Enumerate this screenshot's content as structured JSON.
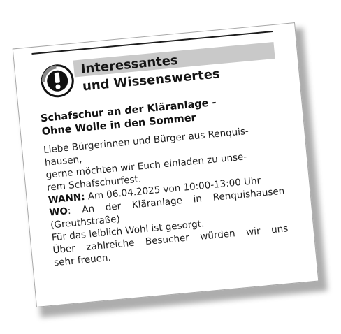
{
  "notice": {
    "header_title_line1": "Interessantes",
    "header_title_line2": "und Wissenswertes",
    "headline_line1": "Schafschur an der Kläranlage -",
    "headline_line2": "Ohne Wolle in den Sommer",
    "body": {
      "line1": "Liebe Bürgerinnen und Bürger aus Renquis-",
      "line2": "hausen,",
      "line3": "gerne möchten wir Euch einladen zu unse-",
      "line4": "rem Schafschurfest.",
      "when_label": "WANN:",
      "when_value": " Am 06.04.2025 von 10:00-13:00 Uhr",
      "where_label": "WO",
      "where_value": ": An der Kläranlage in Renquishausen",
      "where_line2": "(Greuthstraße)",
      "line_food": "Für das leiblich Wohl ist gesorgt.",
      "line_closing1": "Über zahlreiche Besucher würden wir uns",
      "line_closing2": "sehr freuen."
    },
    "icon": "exclamation-info-icon",
    "colors": {
      "header_band": "#c9c9c9",
      "text": "#1e1e1e"
    }
  }
}
